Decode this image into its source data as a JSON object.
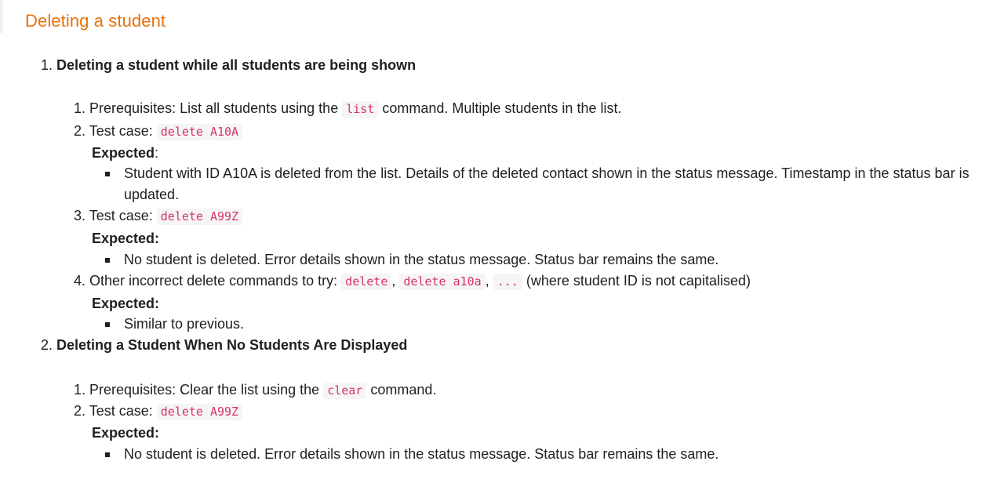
{
  "section": {
    "title": "Deleting a student"
  },
  "cases": [
    {
      "number": "1.",
      "title": "Deleting a student while all students are being shown",
      "steps": [
        {
          "number": "1.",
          "before": "Prerequisites: List all students using the ",
          "code": "list",
          "after": " command. Multiple students in the list."
        },
        {
          "number": "2.",
          "label": "Test case: ",
          "code": "delete A10A",
          "expected_label": "Expected",
          "expected_colon": ":",
          "expected_text": "Student with ID A10A is deleted from the list. Details of the deleted contact shown in the status message. Timestamp in the status bar is updated."
        },
        {
          "number": "3.",
          "label": "Test case: ",
          "code": "delete A99Z",
          "expected_label": "Expected:",
          "expected_text": "No student is deleted. Error details shown in the status message. Status bar remains the same."
        },
        {
          "number": "4.",
          "label": "Other incorrect delete commands to try: ",
          "codes": [
            "delete",
            "delete a10a",
            "..."
          ],
          "separators": [
            ", ",
            ", "
          ],
          "after": " (where student ID is not capitalised)",
          "expected_label": "Expected:",
          "expected_text": "Similar to previous."
        }
      ]
    },
    {
      "number": "2.",
      "title": "Deleting a Student When No Students Are Displayed",
      "steps": [
        {
          "number": "1.",
          "before": "Prerequisites: Clear the list using the ",
          "code": "clear",
          "after": " command."
        },
        {
          "number": "2.",
          "label": "Test case: ",
          "code": "delete A99Z",
          "expected_label": "Expected:",
          "expected_text": "No student is deleted. Error details shown in the status message. Status bar remains the same."
        }
      ]
    }
  ]
}
